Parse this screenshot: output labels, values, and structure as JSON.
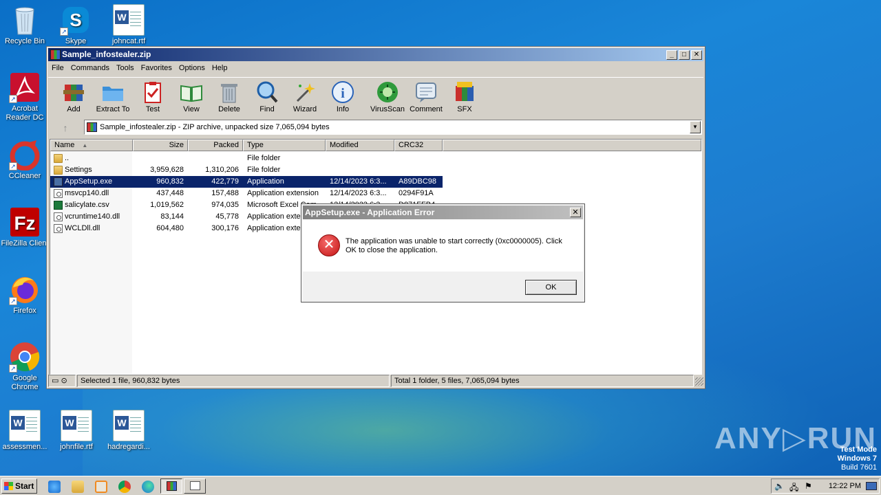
{
  "desktop": {
    "icons": [
      {
        "label": "Recycle Bin",
        "icon": "recycle-bin-icon"
      },
      {
        "label": "Skype",
        "icon": "skype-icon"
      },
      {
        "label": "johncat.rtf",
        "icon": "word-document-icon"
      },
      {
        "label": "Acrobat Reader DC",
        "icon": "acrobat-icon"
      },
      {
        "label": "CCleaner",
        "icon": "ccleaner-icon"
      },
      {
        "label": "FileZilla Client",
        "icon": "filezilla-icon"
      },
      {
        "label": "Firefox",
        "icon": "firefox-icon"
      },
      {
        "label": "Google Chrome",
        "icon": "chrome-icon"
      },
      {
        "label": "assessmen...",
        "icon": "word-document-icon"
      },
      {
        "label": "johnfile.rtf",
        "icon": "word-document-icon"
      },
      {
        "label": "hadregardi...",
        "icon": "word-document-icon"
      }
    ],
    "watermark": {
      "line1": "Test Mode",
      "line2": "Windows 7",
      "line3": "Build 7601"
    },
    "anyrun": "ANY▷RUN"
  },
  "window": {
    "title": "Sample_infostealer.zip",
    "menu": [
      "File",
      "Commands",
      "Tools",
      "Favorites",
      "Options",
      "Help"
    ],
    "toolbar": [
      "Add",
      "Extract To",
      "Test",
      "View",
      "Delete",
      "Find",
      "Wizard",
      "Info",
      "VirusScan",
      "Comment",
      "SFX"
    ],
    "address": "Sample_infostealer.zip - ZIP archive, unpacked size 7,065,094 bytes",
    "columns": [
      "Name",
      "Size",
      "Packed",
      "Type",
      "Modified",
      "CRC32"
    ],
    "rows": [
      {
        "name": "..",
        "size": "",
        "packed": "",
        "type": "File folder",
        "modified": "",
        "crc": "",
        "kind": "folder"
      },
      {
        "name": "Settings",
        "size": "3,959,628",
        "packed": "1,310,206",
        "type": "File folder",
        "modified": "",
        "crc": "",
        "kind": "folder"
      },
      {
        "name": "AppSetup.exe",
        "size": "960,832",
        "packed": "422,779",
        "type": "Application",
        "modified": "12/14/2023 6:3...",
        "crc": "A89DBC98",
        "kind": "exe"
      },
      {
        "name": "msvcp140.dll",
        "size": "437,448",
        "packed": "157,488",
        "type": "Application extension",
        "modified": "12/14/2023 6:3...",
        "crc": "0294F91A",
        "kind": "dll"
      },
      {
        "name": "salicylate.csv",
        "size": "1,019,562",
        "packed": "974,035",
        "type": "Microsoft Excel Com...",
        "modified": "12/14/2023 6:3...",
        "crc": "D871FFB4",
        "kind": "csv"
      },
      {
        "name": "vcruntime140.dll",
        "size": "83,144",
        "packed": "45,778",
        "type": "Application exten...",
        "modified": "",
        "crc": "",
        "kind": "dll"
      },
      {
        "name": "WCLDll.dll",
        "size": "604,480",
        "packed": "300,176",
        "type": "Application exten...",
        "modified": "",
        "crc": "",
        "kind": "dll"
      }
    ],
    "status_left": "Selected 1 file, 960,832 bytes",
    "status_right": "Total 1 folder, 5 files, 7,065,094 bytes"
  },
  "dialog": {
    "title": "AppSetup.exe - Application Error",
    "message": "The application was unable to start correctly (0xc0000005). Click OK to close the application.",
    "ok": "OK"
  },
  "taskbar": {
    "start": "Start",
    "clock": "12:22 PM"
  }
}
